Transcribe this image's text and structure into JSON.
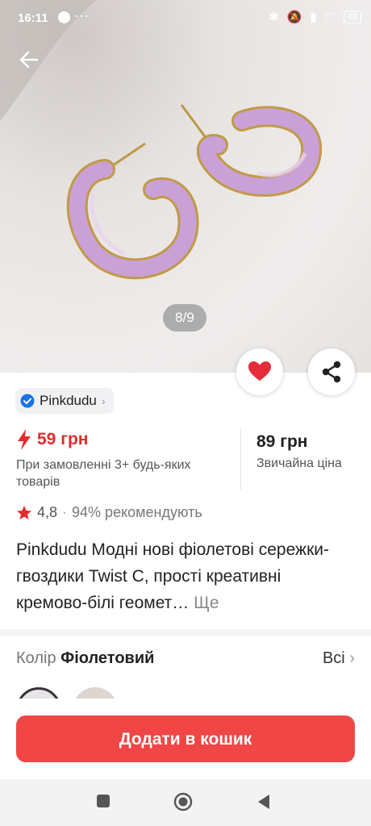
{
  "status_bar": {
    "time": "16:11",
    "battery": "48"
  },
  "gallery": {
    "counter": "8/9"
  },
  "store": {
    "name": "Pinkdudu"
  },
  "price": {
    "promo_price": "59 грн",
    "promo_note": "При замовленні 3+ будь-яких товарів",
    "regular_price": "89 грн",
    "regular_note": "Звичайна ціна"
  },
  "rating": {
    "value": "4,8",
    "separator": "·",
    "recommend": "94% рекомендують"
  },
  "product": {
    "title": "Pinkdudu Модні нові фіолетові сережки-гвоздики Twist C, прості креативні кремово-білі геомет…",
    "more": "Ще"
  },
  "variant": {
    "label": "Колір",
    "value": "Фіолетовий",
    "all": "Всі"
  },
  "cart": {
    "button": "Додати в кошик"
  },
  "colors": {
    "accent": "#f04646",
    "promo": "#e22c2c",
    "verified": "#1a73e8"
  }
}
